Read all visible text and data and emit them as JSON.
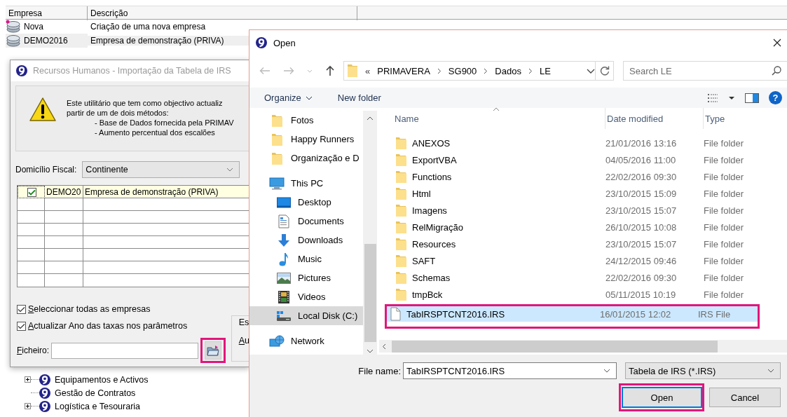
{
  "background": {
    "columns": [
      "Empresa",
      "Descrição"
    ],
    "rows": [
      {
        "kind": "new",
        "company": "Nova",
        "description": "Criação de uma nova empresa",
        "selected": false
      },
      {
        "kind": "existing",
        "company": "DEMO2016",
        "description": "Empresa de demonstração (PRIVA)",
        "selected": true
      }
    ],
    "tree": [
      {
        "label": "Equipamentos e Activos",
        "expandable": true
      },
      {
        "label": "Gestão de Contratos",
        "expandable": false
      },
      {
        "label": "Logística e Tesouraria",
        "expandable": true
      }
    ]
  },
  "import_dialog": {
    "title": "Recursos Humanos - Importação da Tabela de IRS",
    "message": [
      "Este utilitário que tem como objectivo actualiz",
      "partir de um de dois métodos:"
    ],
    "methods": [
      "- Base de Dados fornecida pela PRIMAV",
      "- Aumento percentual dos escalões"
    ],
    "fiscal_label": "Domicílio Fiscal:",
    "fiscal_value": "Continente",
    "companies": [
      {
        "checked": true,
        "code": "DEMO20",
        "name": "Empresa de demonstração (PRIVA)"
      }
    ],
    "options": [
      {
        "label": "Seleccionar todas as empresas",
        "checked": true
      },
      {
        "label": "Actualizar Ano das taxas nos parâmetros",
        "checked": true
      }
    ],
    "group_fragments": [
      "Es",
      "Au"
    ],
    "file_label": "Ficheiro:",
    "browse_highlighted": true
  },
  "open_dialog": {
    "title": "Open",
    "path_prefix": "«",
    "path": [
      "PRIMAVERA",
      "SG900",
      "Dados",
      "LE"
    ],
    "search_placeholder": "Search LE",
    "toolbar": [
      {
        "label": "Organize",
        "kind": "menu"
      },
      {
        "label": "New folder",
        "kind": "button"
      }
    ],
    "help": "?",
    "nav": [
      {
        "label": "Fotos",
        "kind": "folder",
        "selected": false
      },
      {
        "label": "Happy Runners",
        "kind": "folder",
        "selected": false
      },
      {
        "label": "Organização e D",
        "kind": "folder",
        "selected": false
      },
      {
        "label": "This PC",
        "kind": "pc",
        "selected": false,
        "children": [
          {
            "label": "Desktop",
            "kind": "desktop",
            "selected": false
          },
          {
            "label": "Documents",
            "kind": "documents",
            "selected": false
          },
          {
            "label": "Downloads",
            "kind": "downloads",
            "selected": false
          },
          {
            "label": "Music",
            "kind": "music",
            "selected": false
          },
          {
            "label": "Pictures",
            "kind": "pictures",
            "selected": false
          },
          {
            "label": "Videos",
            "kind": "videos",
            "selected": false
          },
          {
            "label": "Local Disk (C:)",
            "kind": "disk",
            "selected": true
          }
        ]
      },
      {
        "label": "Network",
        "kind": "network",
        "selected": false
      }
    ],
    "columns": [
      "Name",
      "Date modified",
      "Type"
    ],
    "files": [
      {
        "kind": "folder",
        "name": "ANEXOS",
        "date": "21/01/2016 13:16",
        "type": "File folder",
        "selected": false,
        "highlighted": false
      },
      {
        "kind": "folder",
        "name": "ExportVBA",
        "date": "04/05/2016 11:00",
        "type": "File folder",
        "selected": false,
        "highlighted": false
      },
      {
        "kind": "folder",
        "name": "Functions",
        "date": "22/02/2016 09:30",
        "type": "File folder",
        "selected": false,
        "highlighted": false
      },
      {
        "kind": "folder",
        "name": "Html",
        "date": "23/10/2015 15:09",
        "type": "File folder",
        "selected": false,
        "highlighted": false
      },
      {
        "kind": "folder",
        "name": "Imagens",
        "date": "23/10/2015 15:07",
        "type": "File folder",
        "selected": false,
        "highlighted": false
      },
      {
        "kind": "folder",
        "name": "RelMigração",
        "date": "26/10/2015 10:08",
        "type": "File folder",
        "selected": false,
        "highlighted": false
      },
      {
        "kind": "folder",
        "name": "Resources",
        "date": "23/10/2015 15:07",
        "type": "File folder",
        "selected": false,
        "highlighted": false
      },
      {
        "kind": "folder",
        "name": "SAFT",
        "date": "24/12/2015 09:46",
        "type": "File folder",
        "selected": false,
        "highlighted": false
      },
      {
        "kind": "folder",
        "name": "Schemas",
        "date": "22/02/2016 09:30",
        "type": "File folder",
        "selected": false,
        "highlighted": false
      },
      {
        "kind": "folder",
        "name": "tmpBck",
        "date": "05/11/2015 10:19",
        "type": "File folder",
        "selected": false,
        "highlighted": false
      },
      {
        "kind": "file",
        "name": "TabIRSPTCNT2016.IRS",
        "date": "16/01/2015 12:02",
        "type": "IRS File",
        "selected": true,
        "highlighted": true
      }
    ],
    "file_name_label": "File name:",
    "file_name": "TabIRSPTCNT2016.IRS",
    "filter": "Tabela de IRS (*.IRS)",
    "buttons": [
      {
        "label": "Open",
        "default": true,
        "highlighted": true
      },
      {
        "label": "Cancel",
        "default": false,
        "highlighted": false
      }
    ]
  }
}
